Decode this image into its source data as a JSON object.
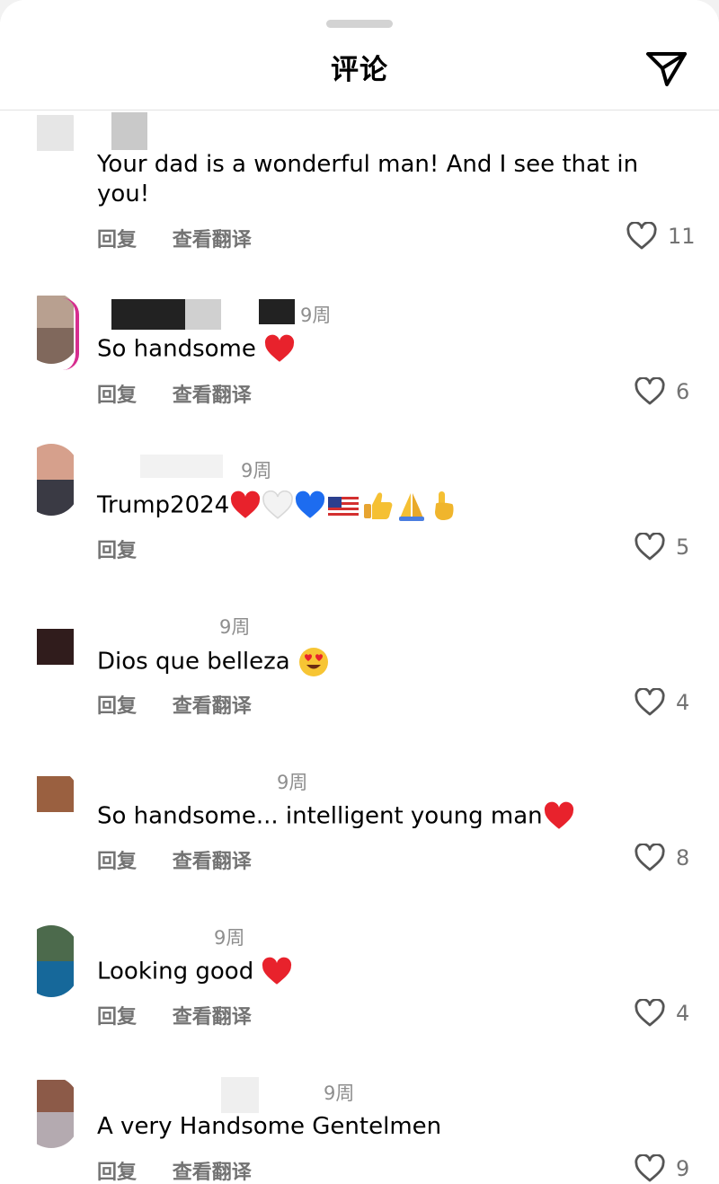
{
  "header": {
    "title": "评论",
    "send_icon": "paper-plane-icon"
  },
  "labels": {
    "reply": "回复",
    "translate": "查看翻译"
  },
  "colors": {
    "heart_red": "#e8222c",
    "secondary_text": "#737373",
    "time_text": "#8e8e8e",
    "divider": "#e3e3e3",
    "white_heart": "#eeeeee",
    "blue_heart": "#1d6cf0"
  },
  "comments": [
    {
      "text": "Your dad is a wonderful man! And I see that in you!",
      "likes": "11",
      "time": ""
    },
    {
      "text": "So handsome",
      "likes": "6",
      "time": "9周"
    },
    {
      "text": "Trump2024",
      "likes": "5",
      "time": "9周"
    },
    {
      "text": "Dios que belleza",
      "likes": "4",
      "time": "9周"
    },
    {
      "text": "So handsome... intelligent young man",
      "likes": "8",
      "time": "9周"
    },
    {
      "text": "Looking good",
      "likes": "4",
      "time": "9周"
    },
    {
      "text": "A very Handsome Gentelmen",
      "likes": "9",
      "time": "9周"
    }
  ]
}
